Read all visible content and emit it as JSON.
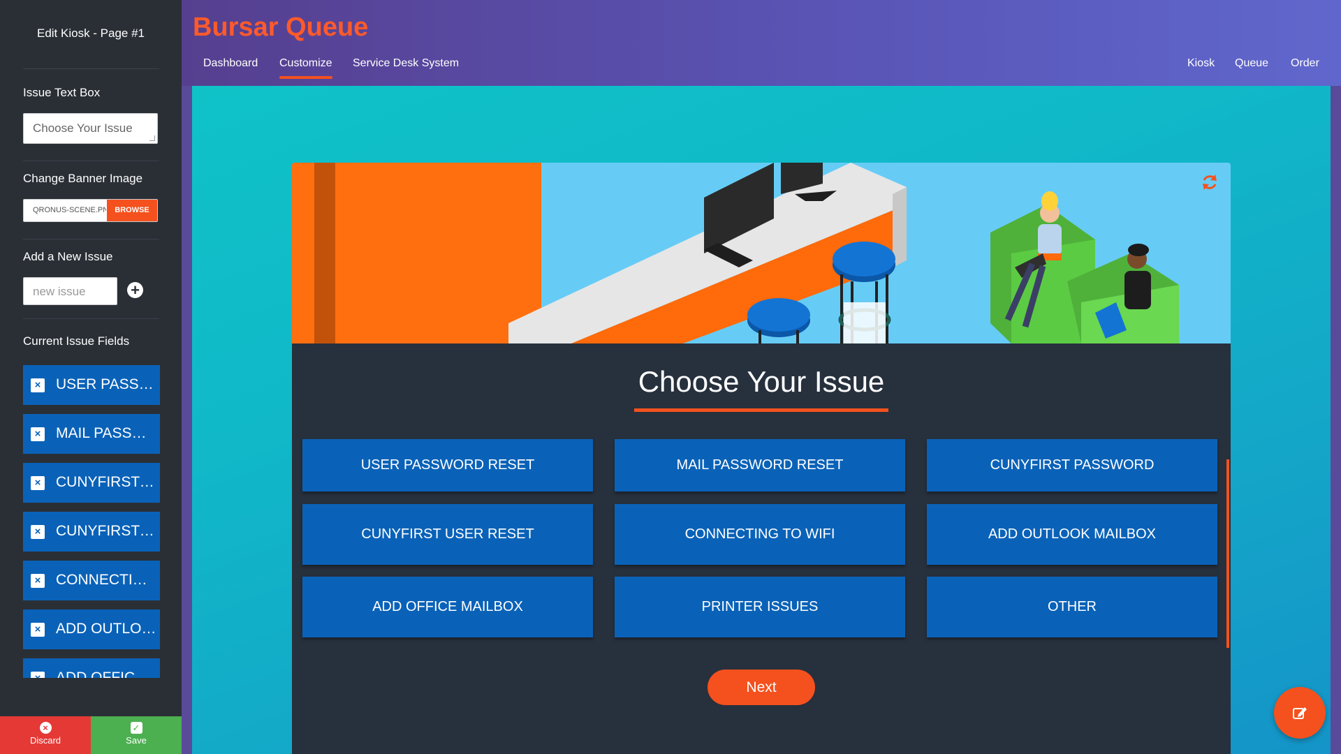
{
  "sidebar": {
    "title": "Edit Kiosk - Page #1",
    "issue_text_box": {
      "label": "Issue Text Box",
      "value": "Choose Your Issue"
    },
    "banner_image": {
      "label": "Change Banner Image",
      "file_name": "QRONUS-SCENE.PNG",
      "browse_label": "BROWSE"
    },
    "add_issue": {
      "label": "Add a New Issue",
      "placeholder": "new issue"
    },
    "current_fields": {
      "label": "Current Issue Fields",
      "items": [
        "USER PASSWORD RESET",
        "MAIL PASSWORD RESET",
        "CUNYFIRST PASSWORD",
        "CUNYFIRST USER RESET",
        "CONNECTING TO WIFI",
        "ADD OUTLOOK MAILBOX",
        "ADD OFFICE MAILBOX"
      ]
    },
    "discard_label": "Discard",
    "save_label": "Save"
  },
  "header": {
    "title": "Bursar Queue",
    "tabs": [
      "Dashboard",
      "Customize",
      "Service Desk System"
    ],
    "active_tab": "Customize",
    "right_links": [
      "Kiosk",
      "Queue",
      "Order"
    ]
  },
  "kiosk": {
    "heading": "Choose Your Issue",
    "issues": [
      "USER PASSWORD RESET",
      "MAIL PASSWORD RESET",
      "CUNYFIRST PASSWORD",
      "CUNYFIRST USER RESET",
      "CONNECTING TO WIFI",
      "ADD OUTLOOK MAILBOX",
      "ADD OFFICE MAILBOX",
      "PRINTER ISSUES",
      "OTHER"
    ],
    "next_label": "Next"
  },
  "colors": {
    "accent": "#f4511e",
    "primary_button": "#0a62b8",
    "sidebar_bg": "#2a2f36",
    "kiosk_bg": "#27303d",
    "discard": "#e53935",
    "save": "#4caf50"
  }
}
